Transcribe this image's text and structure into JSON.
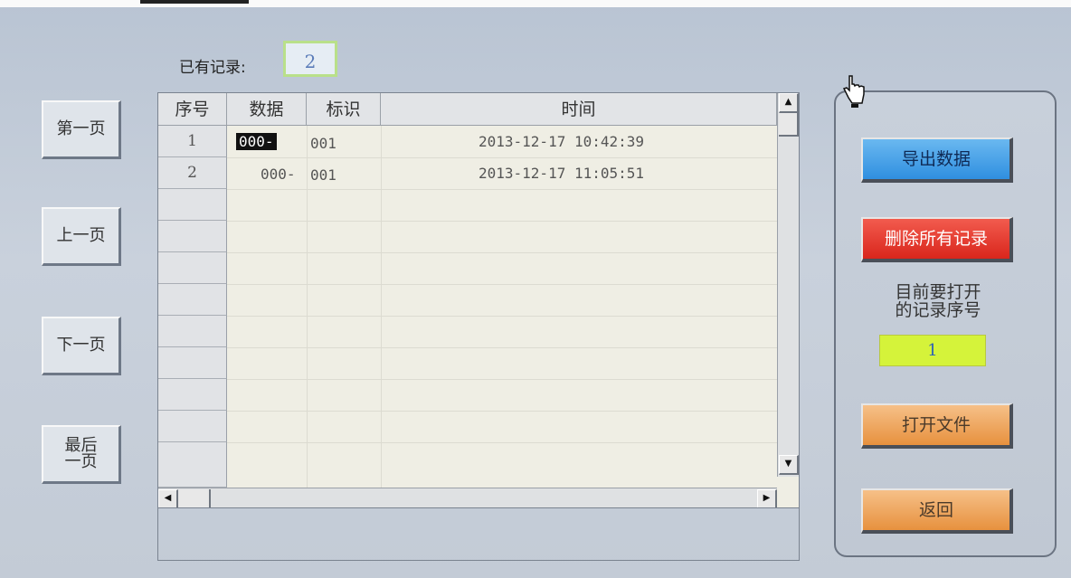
{
  "header": {
    "record_count_label": "已有记录:",
    "record_count_value": "2"
  },
  "nav": {
    "first_page": "第一页",
    "prev_page": "上一页",
    "next_page": "下一页",
    "last_page_line1": "最后",
    "last_page_line2": "一页"
  },
  "table": {
    "columns": [
      "序号",
      "数据",
      "标识",
      "时间"
    ],
    "rows": [
      {
        "seq": "1",
        "data": "000-",
        "flag": "001",
        "time": "2013-12-17 10:42:39"
      },
      {
        "seq": "2",
        "data": "000-",
        "flag": "001",
        "time": "2013-12-17 11:05:51"
      }
    ]
  },
  "actions": {
    "export": "导出数据",
    "delete_all": "删除所有记录",
    "open_label_line1": "目前要打开",
    "open_label_line2": "的记录序号",
    "open_index_value": "1",
    "open_file": "打开文件",
    "back": "返回"
  },
  "colors": {
    "export_button": "#2f8fe0",
    "delete_button": "#d9261c",
    "orange_button": "#e7913e",
    "open_index_field": "#d5f33a"
  },
  "icons": {
    "cursor": "hand-pointer-icon",
    "scroll_up": "triangle-up-icon",
    "scroll_down": "triangle-down-icon",
    "scroll_left": "triangle-left-icon",
    "scroll_right": "triangle-right-icon"
  }
}
